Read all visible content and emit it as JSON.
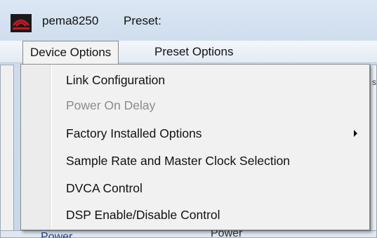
{
  "app": {
    "title": "pema8250",
    "preset_label": "Preset:",
    "brand_color": "#c0191f"
  },
  "menu_bar": {
    "items": [
      {
        "label": "Device Options",
        "active": true
      },
      {
        "label": "Preset Options",
        "active": false
      }
    ]
  },
  "dropdown": {
    "items": [
      {
        "label": "Link Configuration",
        "enabled": true,
        "submenu": false
      },
      {
        "label": "Power On Delay",
        "enabled": false,
        "submenu": false
      },
      {
        "label": "Factory Installed Options",
        "enabled": true,
        "submenu": true
      },
      {
        "label": "Sample Rate and Master Clock Selection",
        "enabled": true,
        "submenu": false
      },
      {
        "label": "DVCA Control",
        "enabled": true,
        "submenu": false
      },
      {
        "label": "DSP Enable/Disable Control",
        "enabled": true,
        "submenu": false
      }
    ]
  },
  "background": {
    "left_label": "Power",
    "right_label": "Power",
    "edge_glyph": "s"
  }
}
